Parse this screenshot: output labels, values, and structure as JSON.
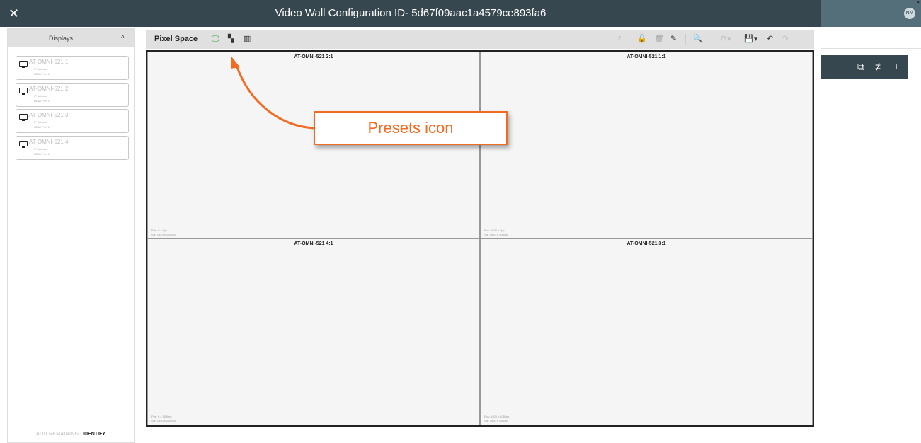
{
  "window": {
    "title": "Video Wall Configuration ID- 5d67f09aac1a4579ce893fa6",
    "close_icon": "✕",
    "avatar_initials": "NM"
  },
  "background_toolbar": {
    "icons": [
      "monitor-group-icon",
      "tune-icon",
      "plus-icon"
    ],
    "monitor_glyph": "⧉",
    "tune_glyph": "≢",
    "plus_glyph": "+"
  },
  "displays": {
    "title": "Displays",
    "chevron": "^",
    "items": [
      {
        "name": "AT-OMNI-521 1",
        "ip_label": "IP Address",
        "hdmi_label": "HDMI Port    1"
      },
      {
        "name": "AT-OMNI-521 2",
        "ip_label": "IP Address",
        "hdmi_label": "HDMI Port    1"
      },
      {
        "name": "AT-OMNI-521 3",
        "ip_label": "IP Address",
        "hdmi_label": "HDMI Port    1"
      },
      {
        "name": "AT-OMNI-521 4",
        "ip_label": "IP Address",
        "hdmi_label": "HDMI Port    1"
      }
    ],
    "footer": {
      "add_remaining": "ADD REMAINING",
      "separator": "|",
      "identify": "IDENTIFY"
    }
  },
  "pixel_space": {
    "title": "Pixel Space",
    "left_icons": {
      "display_glyph": "🖵",
      "presets_glyph": "▚",
      "layout_glyph": "▥"
    },
    "right_icons": {
      "grid_glyph": "⁙",
      "lock_glyph": "🔓",
      "delete_glyph": "🗑",
      "edit_glyph": "✎",
      "zoom_glyph": "🔍",
      "sync_glyph": "⟳▾",
      "save_glyph": "💾▾",
      "undo_glyph": "↶",
      "redo_glyph": "↷"
    },
    "accent_color": "#2e9e34",
    "lock_color": "#e53935",
    "cells": [
      {
        "label": "AT-OMNI-521 2:1",
        "pos": "Pos: 0 x 0px",
        "size": "Siz: 1920 x 1080px"
      },
      {
        "label": "AT-OMNI-521 1:1",
        "pos": "Pos: 1920 x 0px",
        "size": "Siz: 1920 x 1080px"
      },
      {
        "label": "AT-OMNI-521 4:1",
        "pos": "Pos: 0 x 1080px",
        "size": "Siz: 1920 x 1080px"
      },
      {
        "label": "AT-OMNI-521 3:1",
        "pos": "Pos: 1920 x 1080px",
        "size": "Siz: 1920 x 1080px"
      }
    ]
  },
  "annotation": {
    "callout_text": "Presets icon",
    "color": "#f26b21"
  }
}
